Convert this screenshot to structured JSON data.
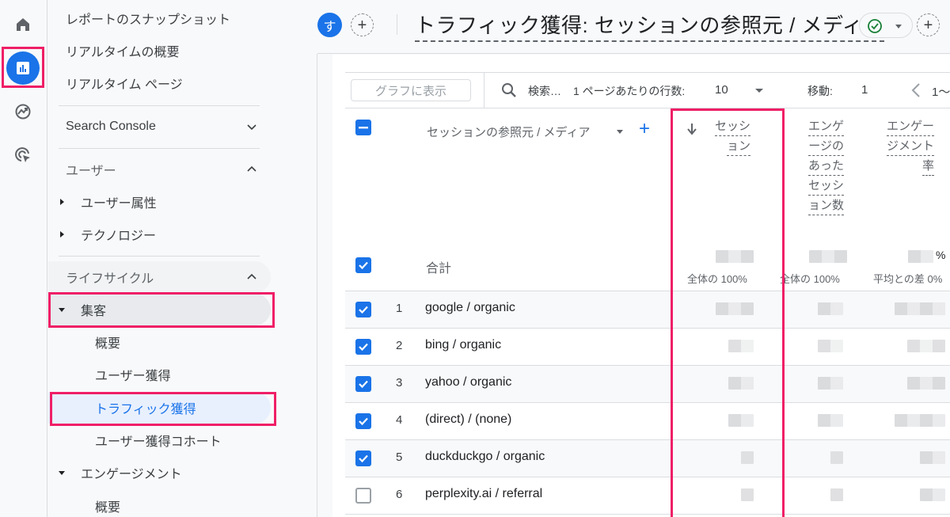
{
  "rail": {
    "items": [
      {
        "name": "home",
        "icon": "home-icon"
      },
      {
        "name": "reports",
        "icon": "bar-chart-icon",
        "active": true
      },
      {
        "name": "explore",
        "icon": "explore-trend-icon"
      },
      {
        "name": "advertising",
        "icon": "cursor-target-icon"
      }
    ]
  },
  "nav": {
    "top_items": [
      "レポートのスナップショット",
      "リアルタイムの概要",
      "リアルタイム ページ"
    ],
    "search_console": "Search Console",
    "user_section": "ユーザー",
    "user_items": [
      "ユーザー属性",
      "テクノロジー"
    ],
    "lifecycle_section": "ライフサイクル",
    "acquisition": "集客",
    "acquisition_items": [
      "概要",
      "ユーザー獲得",
      "トラフィック獲得",
      "ユーザー獲得コホート"
    ],
    "engagement": "エンゲージメント",
    "engagement_items": [
      "概要"
    ],
    "selected": "トラフィック獲得"
  },
  "header": {
    "avatar_letter": "す",
    "title": "トラフィック獲得: セッションの参照元 / メディア",
    "status": "check-circle-icon"
  },
  "toolbar": {
    "graph_button": "グラフに表示",
    "search_placeholder": "検索…",
    "rows_per_page_label": "1 ページあたりの行数:",
    "rows_per_page_value": "10",
    "goto_label": "移動:",
    "goto_value": "1",
    "range_partial": "1〜"
  },
  "table": {
    "dimension_header": "セッションの参照元 / メディア",
    "metric_headers": [
      {
        "lines": [
          "セッシ",
          "ョン"
        ],
        "sorted": true
      },
      {
        "lines": [
          "エンゲ",
          "ージの",
          "あった",
          "セッシ",
          "ョン数"
        ]
      },
      {
        "lines": [
          "エンゲー",
          "ジメント",
          "率"
        ]
      }
    ],
    "total_label": "合計",
    "total_notes": [
      "全体の 100%",
      "全体の 100%",
      "平均との差 0%"
    ],
    "total_suffix_3": "%",
    "rows": [
      {
        "rank": "1",
        "name": "google / organic",
        "checked": true
      },
      {
        "rank": "2",
        "name": "bing / organic",
        "checked": true
      },
      {
        "rank": "3",
        "name": "yahoo / organic",
        "checked": true
      },
      {
        "rank": "4",
        "name": "(direct) / (none)",
        "checked": true
      },
      {
        "rank": "5",
        "name": "duckduckgo / organic",
        "checked": true
      },
      {
        "rank": "6",
        "name": "perplexity.ai / referral",
        "checked": false
      }
    ],
    "values_note": "metric values are pixelated (obscured) in the screenshot"
  },
  "colors": {
    "accent": "#1a73e8",
    "highlight_box": "#ef1f66",
    "selected_nav_bg": "#e8f0fe",
    "selected_nav_text": "#1a73e8",
    "status_green": "#188038"
  }
}
